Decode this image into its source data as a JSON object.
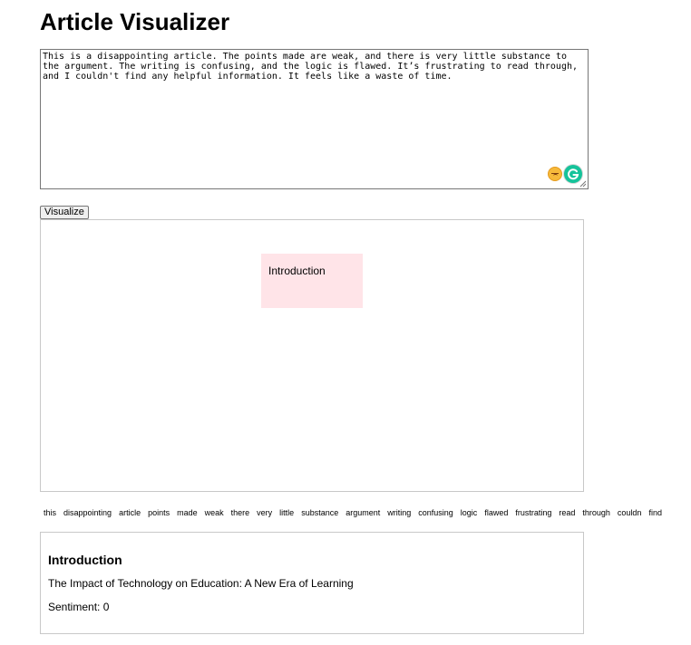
{
  "page": {
    "title": "Article Visualizer"
  },
  "editor": {
    "value": "This is a disappointing article. The points made are weak, and there is very little substance to the argument. The writing is confusing, and the logic is flawed. It’s frustrating to read through, and I couldn't find any helpful information. It feels like a waste of time.",
    "sentiment_emoji": "sad-face-icon",
    "extension_icon": "grammarly-icon"
  },
  "toolbar": {
    "visualize_label": "Visualize"
  },
  "canvas": {
    "nodes": [
      {
        "label": "Introduction",
        "color": "#ffe4e8"
      }
    ]
  },
  "keywords": [
    "this",
    "disappointing",
    "article",
    "points",
    "made",
    "weak",
    "there",
    "very",
    "little",
    "substance",
    "argument",
    "writing",
    "confusing",
    "logic",
    "flawed",
    "frustrating",
    "read",
    "through",
    "couldn",
    "find"
  ],
  "details": {
    "heading": "Introduction",
    "text": "The Impact of Technology on Education: A New Era of Learning",
    "sentiment": "Sentiment: 0"
  }
}
